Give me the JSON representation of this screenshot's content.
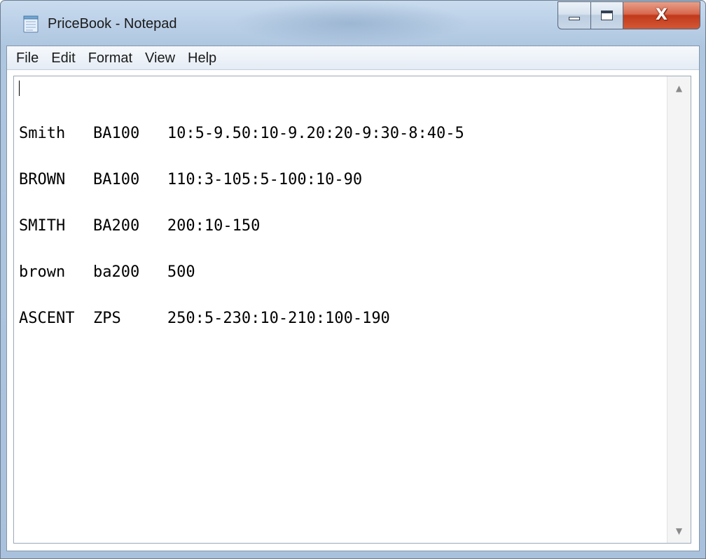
{
  "window": {
    "title": "PriceBook - Notepad",
    "icon": "notepad-icon",
    "controls": {
      "minimize_icon": "minimize-icon",
      "maximize_icon": "maximize-icon",
      "close_label": "X"
    }
  },
  "menubar": {
    "items": [
      "File",
      "Edit",
      "Format",
      "View",
      "Help"
    ]
  },
  "document": {
    "lines": [
      "Smith   BA100   10:5-9.50:10-9.20:20-9:30-8:40-5",
      "BROWN   BA100   110:3-105:5-100:10-90",
      "SMITH   BA200   200:10-150",
      "brown   ba200   500",
      "ASCENT  ZPS     250:5-230:10-210:100-190"
    ]
  },
  "scrollbar": {
    "up_arrow": "▲",
    "down_arrow": "▼"
  },
  "colors": {
    "title_bar": "#bcd1e8",
    "close_button": "#c1391a",
    "editor_background": "#ffffff",
    "text": "#000000"
  }
}
